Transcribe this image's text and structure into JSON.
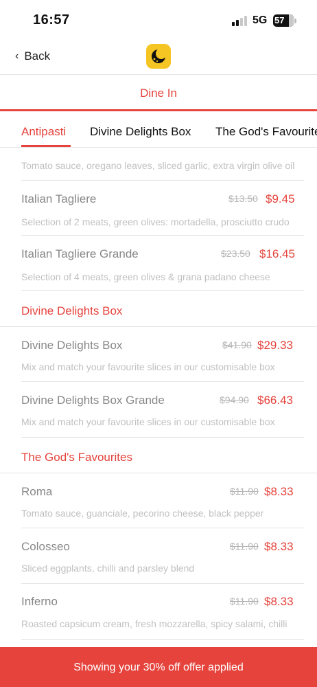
{
  "status_bar": {
    "time": "16:57",
    "network": "5G",
    "battery": "57"
  },
  "nav": {
    "back_label": "Back",
    "logo_icon": "moon-pizza-icon",
    "logo_color": "#f5c623"
  },
  "dine": {
    "label": "Dine In"
  },
  "tabs": [
    {
      "label": "Antipasti",
      "active": true
    },
    {
      "label": "Divine Delights Box",
      "active": false
    },
    {
      "label": "The God's Favourites",
      "active": false
    }
  ],
  "menu": {
    "partial_desc": "Tomato sauce, oregano leaves, sliced garlic, extra virgin olive oil",
    "antipasti": [
      {
        "name": "Italian Tagliere",
        "old_price": "$13.50",
        "new_price": "$9.45",
        "desc": "Selection of 2 meats, green olives: mortadella, prosciutto crudo"
      },
      {
        "name": "Italian Tagliere Grande",
        "old_price": "$23.50",
        "new_price": "$16.45",
        "desc": "Selection of 4 meats, green olives & grana padano cheese"
      }
    ],
    "section_divine": "Divine Delights Box",
    "divine": [
      {
        "name": "Divine Delights Box",
        "old_price": "$41.90",
        "new_price": "$29.33",
        "desc": "Mix and match your favourite slices in our customisable box"
      },
      {
        "name": "Divine Delights Box Grande",
        "old_price": "$94.90",
        "new_price": "$66.43",
        "desc": "Mix and match your favourite slices in our customisable box"
      }
    ],
    "section_gods": "The God's Favourites",
    "gods": [
      {
        "name": "Roma",
        "old_price": "$11.90",
        "new_price": "$8.33",
        "desc": "Tomato sauce, guanciale, pecorino cheese, black pepper"
      },
      {
        "name": "Colosseo",
        "old_price": "$11.90",
        "new_price": "$8.33",
        "desc": "Sliced eggplants, chilli and parsley blend"
      },
      {
        "name": "Inferno",
        "old_price": "$11.90",
        "new_price": "$8.33",
        "desc": "Roasted capsicum cream, fresh mozzarella, spicy salami, chilli"
      }
    ]
  },
  "offer": {
    "text": "Showing your 30% off offer applied"
  },
  "colors": {
    "accent": "#e5433c",
    "muted_text": "#888888",
    "desc_text": "#c0c0c0"
  }
}
